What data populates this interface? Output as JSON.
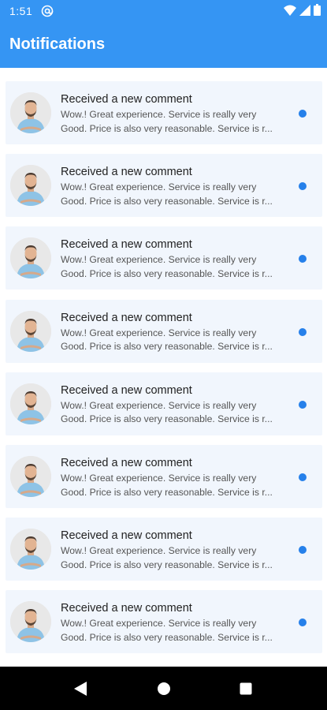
{
  "status_bar": {
    "time": "1:51",
    "icons": [
      "at-sign-icon",
      "wifi-icon",
      "cellular-signal-icon",
      "battery-icon"
    ]
  },
  "app_bar": {
    "title": "Notifications"
  },
  "colors": {
    "primary": "#3595f3",
    "card_background": "#f1f6fd",
    "unread_dot": "#2680ea",
    "nav_bar": "#000000"
  },
  "notifications": [
    {
      "title": "Received a new comment",
      "line1": "Wow.! Great experience. Service is really very",
      "line2": "Good. Price is also very reasonable. Service is r...",
      "unread": true
    },
    {
      "title": "Received a new comment",
      "line1": "Wow.! Great experience. Service is really very",
      "line2": "Good. Price is also very reasonable. Service is r...",
      "unread": true
    },
    {
      "title": "Received a new comment",
      "line1": "Wow.! Great experience. Service is really very",
      "line2": "Good. Price is also very reasonable. Service is r...",
      "unread": true
    },
    {
      "title": "Received a new comment",
      "line1": "Wow.! Great experience. Service is really very",
      "line2": "Good. Price is also very reasonable. Service is r...",
      "unread": true
    },
    {
      "title": "Received a new comment",
      "line1": "Wow.! Great experience. Service is really very",
      "line2": "Good. Price is also very reasonable. Service is r...",
      "unread": true
    },
    {
      "title": "Received a new comment",
      "line1": "Wow.! Great experience. Service is really very",
      "line2": "Good. Price is also very reasonable. Service is r...",
      "unread": true
    },
    {
      "title": "Received a new comment",
      "line1": "Wow.! Great experience. Service is really very",
      "line2": "Good. Price is also very reasonable. Service is r...",
      "unread": true
    },
    {
      "title": "Received a new comment",
      "line1": "Wow.! Great experience. Service is really very",
      "line2": "Good. Price is also very reasonable. Service is r...",
      "unread": true
    }
  ],
  "nav_bar": {
    "buttons": [
      "back-icon",
      "home-icon",
      "recents-icon"
    ]
  }
}
